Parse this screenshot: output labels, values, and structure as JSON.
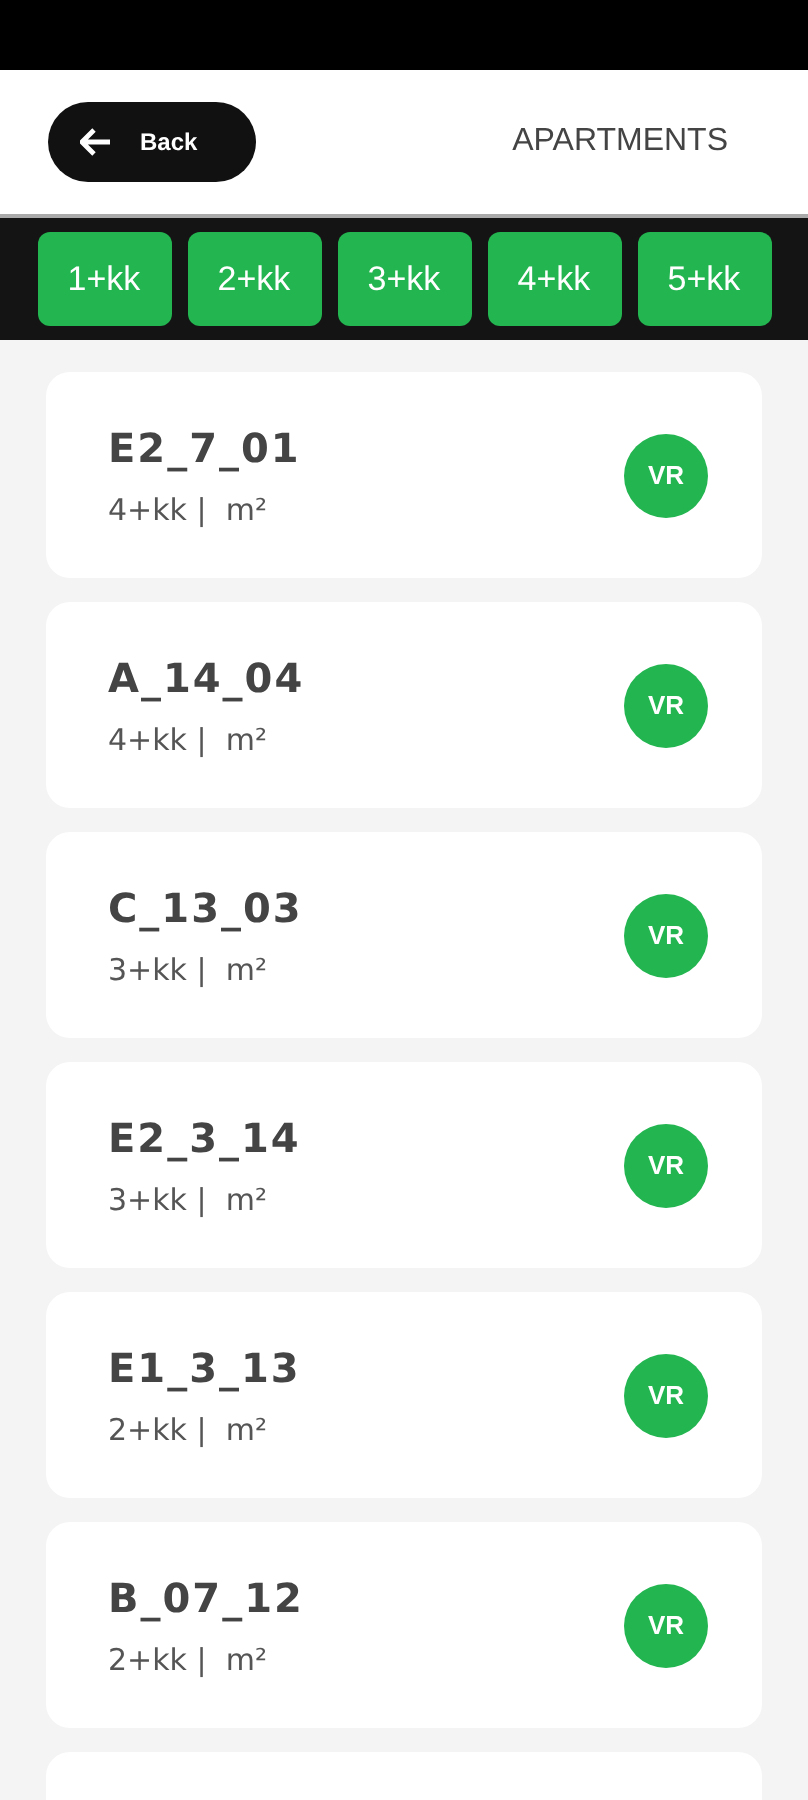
{
  "header": {
    "back_label": "Back",
    "title": "APARTMENTS"
  },
  "filters": [
    {
      "label": "1+kk",
      "selected": false
    },
    {
      "label": "2+kk",
      "selected": false
    },
    {
      "label": "3+kk",
      "selected": false
    },
    {
      "label": "4+kk",
      "selected": false
    },
    {
      "label": "5+kk",
      "selected": false
    }
  ],
  "apartments": [
    {
      "name": "E2_7_01",
      "details": "4+kk |  m²",
      "badge": "VR"
    },
    {
      "name": "A_14_04",
      "details": "4+kk |  m²",
      "badge": "VR"
    },
    {
      "name": "C_13_03",
      "details": "3+kk |  m²",
      "badge": "VR"
    },
    {
      "name": "E2_3_14",
      "details": "3+kk |  m²",
      "badge": "VR"
    },
    {
      "name": "E1_3_13",
      "details": "2+kk |  m²",
      "badge": "VR"
    },
    {
      "name": "B_07_12",
      "details": "2+kk |  m²",
      "badge": "VR"
    }
  ]
}
